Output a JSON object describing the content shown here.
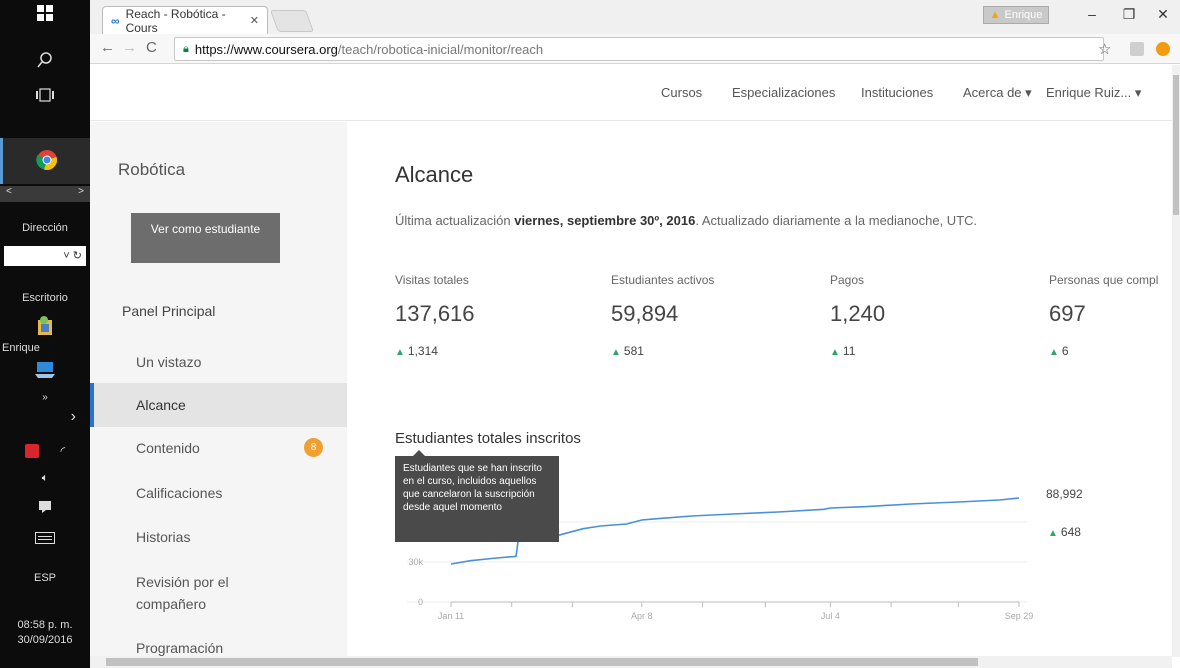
{
  "taskbar": {
    "direccion_label": "Dirección",
    "escritorio_label": "Escritorio",
    "user_label": "Enrique",
    "lang": "ESP",
    "time": "08:58 p. m.",
    "date": "30/09/2016"
  },
  "browser": {
    "tab_title": "Reach - Robótica - Cours",
    "profile_name": "Enrique",
    "url_host": "https://www.coursera.org",
    "url_path": "/teach/robotica-inicial/monitor/reach"
  },
  "header": {
    "nav": [
      "Cursos",
      "Especializaciones",
      "Instituciones",
      "Acerca de ▾",
      "Enrique Ruiz... ▾"
    ]
  },
  "sidebar": {
    "course_title": "Robótica",
    "student_button": "Ver como estudiante",
    "heading": "Panel Principal",
    "items": [
      {
        "label": "Un vistazo"
      },
      {
        "label": "Alcance"
      },
      {
        "label": "Contenido",
        "badge": "8"
      },
      {
        "label": "Calificaciones"
      },
      {
        "label": "Historias"
      },
      {
        "label": "Revisión por el compañero"
      },
      {
        "label": "Programación"
      }
    ]
  },
  "main": {
    "title": "Alcance",
    "updated_prefix": "Última actualización ",
    "updated_date": "viernes, septiembre 30º, 2016",
    "updated_suffix": ". Actualizado diariamente a la medianoche, UTC.",
    "stats": [
      {
        "label": "Visitas totales",
        "value": "137,616",
        "delta": "1,314"
      },
      {
        "label": "Estudiantes activos",
        "value": "59,894",
        "delta": "581"
      },
      {
        "label": "Pagos",
        "value": "1,240",
        "delta": "11"
      },
      {
        "label": "Personas que compl",
        "value": "697",
        "delta": "6"
      }
    ],
    "chart_title": "Estudiantes totales inscritos",
    "tooltip": "Estudiantes que se han inscrito en el curso, incluidos aquellos que cancelaron la suscripción desde aquel momento",
    "last_value": "88,992",
    "last_delta": "648"
  },
  "chart_data": {
    "type": "line",
    "title": "Estudiantes totales inscritos",
    "tick_labels_x": [
      "Jan 11",
      "Apr 8",
      "Jul 4",
      "Sep 29"
    ],
    "tick_labels_y": [
      "0",
      "30k"
    ],
    "ylim": [
      0,
      90000
    ],
    "x": [
      "2016-01-11",
      "2016-01-20",
      "2016-02-01",
      "2016-02-10",
      "2016-02-11",
      "2016-02-25",
      "2016-03-05",
      "2016-03-12",
      "2016-03-20",
      "2016-04-01",
      "2016-04-08",
      "2016-04-15",
      "2016-05-01",
      "2016-05-20",
      "2016-06-10",
      "2016-07-01",
      "2016-07-04",
      "2016-07-20",
      "2016-08-10",
      "2016-09-01",
      "2016-09-20",
      "2016-09-29"
    ],
    "values": [
      28500,
      31000,
      33000,
      34200,
      46000,
      48000,
      52000,
      55000,
      57000,
      58500,
      61500,
      62500,
      64500,
      66000,
      67500,
      69500,
      70500,
      71500,
      73500,
      75000,
      76500,
      78000
    ],
    "last_value": 88992,
    "color": "#4a90d9"
  }
}
